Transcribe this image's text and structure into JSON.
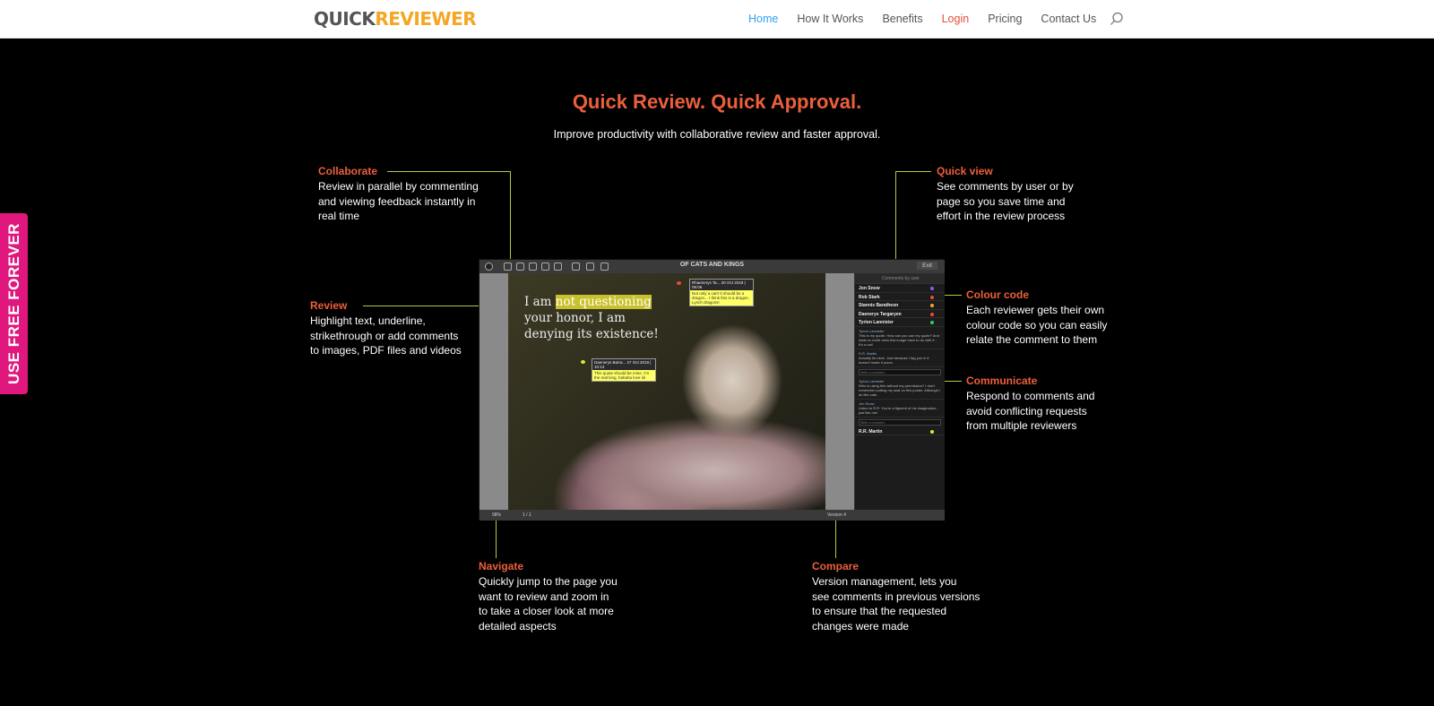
{
  "header": {
    "logo_quick": "QUICK",
    "logo_reviewer": "REVIEWER",
    "nav": [
      "Home",
      "How It Works",
      "Benefits",
      "Login",
      "Pricing",
      "Contact Us"
    ],
    "search_icon": "search-icon"
  },
  "side_tab": {
    "label": "USE FREE FOREVER"
  },
  "hero": {
    "title": "Quick Review. Quick Approval.",
    "subtitle": "Improve productivity with collaborative review and faster approval."
  },
  "features": {
    "collaborate": {
      "title": "Collaborate",
      "desc": "Review in parallel by commenting\nand viewing feedback instantly in\nreal time"
    },
    "review": {
      "title": "Review",
      "desc": "Highlight text, underline,\nstrikethrough or add comments\nto images, PDF files and videos"
    },
    "quick_view": {
      "title": "Quick view",
      "desc": "See comments by user or by\npage so you save time and\neffort in the review process"
    },
    "colour_code": {
      "title": "Colour code",
      "desc": "Each reviewer gets their own\ncolour code so you can easily\nrelate the comment to them"
    },
    "communicate": {
      "title": "Communicate",
      "desc": "Respond to comments and\navoid conflicting requests\nfrom multiple reviewers"
    },
    "navigate": {
      "title": "Navigate",
      "desc": "Quickly jump to the page you\nwant to review and zoom in\nto take a closer look at more\ndetailed aspects"
    },
    "compare": {
      "title": "Compare",
      "desc": "Version management, lets you\nsee comments in previous versions\nto ensure that the requested\nchanges were made"
    }
  },
  "mock": {
    "title": "OF CATS AND KINGS",
    "exit": "Exit",
    "quote_before": "I am ",
    "quote_hl": "not questioning",
    "quote_after": " your honor, I am denying its existence!",
    "note1_head": "Rhaenerys Ta...        20 Oct 2019 | 09:06",
    "note1_body": "Not only a cat!! It should be a dragon... I think this is a dragon. Lynch dragons!",
    "note2_head": "Daenerys Barra...        27 Oct 2019 | 10:13",
    "note2_body": "This quote should be mine. I'm the real king, hahaha love lol",
    "panel_head": "Comments by user",
    "reviewers": [
      {
        "name": "Jon Snow",
        "color": "#8a5cf6"
      },
      {
        "name": "Rob Stark",
        "color": "#e74c3c"
      },
      {
        "name": "Stannis Baratheon",
        "color": "#f5a623"
      },
      {
        "name": "Daenerys Targaryen",
        "color": "#e74c3c"
      },
      {
        "name": "Tyrion Lannister",
        "color": "#2ecc71"
      }
    ],
    "comment1_name": "Tyrion Lannister",
    "comment1_text": "This is my quote. How can you use my quote? And what on earth does this image have to do with it - It's a cat!",
    "comment2_name": "R.R. Martin",
    "comment2_text": "Actually its mine. Just because I tag you in it doesn't make it yours.",
    "input_placeholder": "Write a comment...",
    "comment3_name": "Tyrion Lannister",
    "comment3_text": "Who is using this without my permission? I don't remember putting my seal on this poster. Although I do like cats.",
    "comment4_name": "Jon Snow",
    "comment4_text": "Listen to R.R. You're a figment of his imagination... just like me!",
    "last_reviewer": {
      "name": "R.R. Martin",
      "color": "#e6e62b"
    },
    "zoom": "98%",
    "page": "1 / 1",
    "version": "Version 4"
  },
  "colors": {
    "accent": "#ec5f3b",
    "line": "#b7c944",
    "tab": "#e0187d"
  }
}
